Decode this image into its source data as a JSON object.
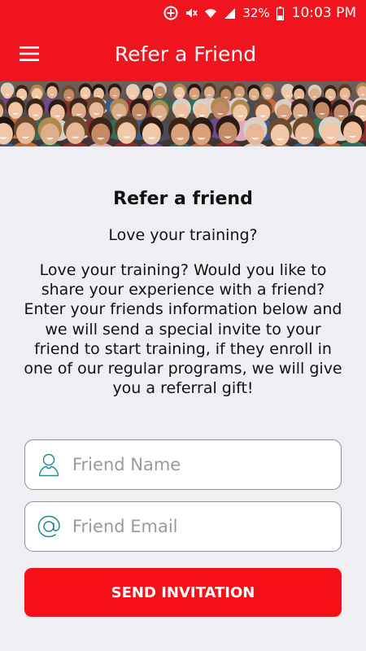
{
  "status_bar": {
    "battery": "32%",
    "time": "10:03 PM",
    "icons": [
      "notification-plus-icon",
      "mute-icon",
      "wifi-icon",
      "signal-icon",
      "battery-icon"
    ]
  },
  "app_bar": {
    "title": "Refer a Friend",
    "menu_icon": "hamburger-menu-icon"
  },
  "banner": {
    "description_icon": "crowd-photo-banner"
  },
  "content": {
    "heading": "Refer a friend",
    "subheading": "Love your training?",
    "body": "Love your training? Would you like to share your experience with a friend? Enter your friends information below and we will send a special invite to your friend to start training, if they enroll in one of our regular programs, we will give you a referral gift!"
  },
  "form": {
    "name_field": {
      "placeholder": "Friend Name",
      "value": "",
      "icon": "person-icon"
    },
    "email_field": {
      "placeholder": "Friend Email",
      "value": "",
      "icon": "at-sign-icon"
    },
    "submit_label": "SEND INVITATION"
  },
  "colors": {
    "primary": "#f0141e",
    "button": "#f50f19",
    "background": "#efeef3",
    "icon_teal": "#1f8a8a"
  }
}
